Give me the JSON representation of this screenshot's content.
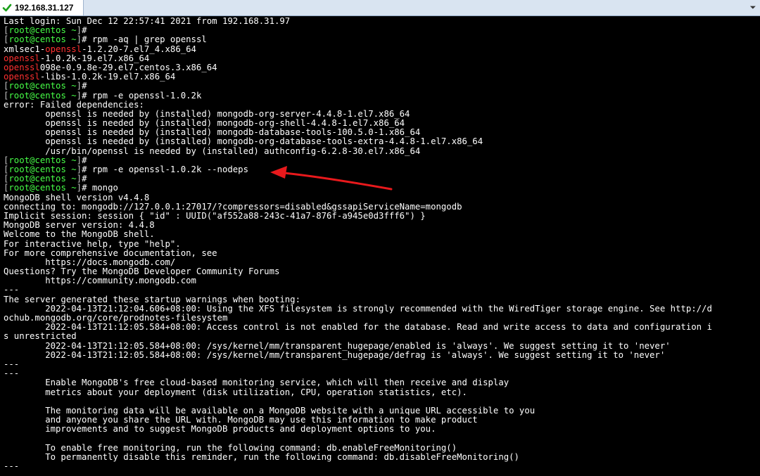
{
  "tab": {
    "title": "192.168.31.127",
    "menu_icon": "chevron-down-icon",
    "status_icon": "check-icon"
  },
  "prompt": {
    "bracket_open": "[",
    "user_host": "root@centos",
    "path": "~",
    "bracket_close": "]",
    "symbol": "#"
  },
  "colors": {
    "prompt_user": "#47ff47",
    "highlight": "#ff3030",
    "arrow": "#e8191c"
  },
  "lines": {
    "l01": "Last login: Sun Dec 12 22:57:41 2021 from 192.168.31.97",
    "l02": "",
    "l03": " rpm -aq | grep openssl",
    "l04a": "xmlsec1-",
    "l04b": "openssl",
    "l04c": "-1.2.20-7.el7_4.x86_64",
    "l05a": "openssl",
    "l05b": "-1.0.2k-19.el7.x86_64",
    "l06a": "openssl",
    "l06b": "098e-0.9.8e-29.el7.centos.3.x86_64",
    "l07a": "openssl",
    "l07b": "-libs-1.0.2k-19.el7.x86_64",
    "l08": "",
    "l09": " rpm -e openssl-1.0.2k",
    "l10": "error: Failed dependencies:",
    "l11": "        openssl is needed by (installed) mongodb-org-server-4.4.8-1.el7.x86_64",
    "l12": "        openssl is needed by (installed) mongodb-org-shell-4.4.8-1.el7.x86_64",
    "l13": "        openssl is needed by (installed) mongodb-database-tools-100.5.0-1.x86_64",
    "l14": "        openssl is needed by (installed) mongodb-org-database-tools-extra-4.4.8-1.el7.x86_64",
    "l15": "        /usr/bin/openssl is needed by (installed) authconfig-6.2.8-30.el7.x86_64",
    "l16": "",
    "l17": " rpm -e openssl-1.0.2k --nodeps",
    "l18": "",
    "l19": " mongo",
    "l20": "MongoDB shell version v4.4.8",
    "l21": "connecting to: mongodb://127.0.0.1:27017/?compressors=disabled&gssapiServiceName=mongodb",
    "l22": "Implicit session: session { \"id\" : UUID(\"af552a88-243c-41a7-876f-a945e0d3fff6\") }",
    "l23": "MongoDB server version: 4.4.8",
    "l24": "Welcome to the MongoDB shell.",
    "l25": "For interactive help, type \"help\".",
    "l26": "For more comprehensive documentation, see",
    "l27": "        https://docs.mongodb.com/",
    "l28": "Questions? Try the MongoDB Developer Community Forums",
    "l29": "        https://community.mongodb.com",
    "l30": "---",
    "l31": "The server generated these startup warnings when booting:",
    "l32": "        2022-04-13T21:12:04.606+08:00: Using the XFS filesystem is strongly recommended with the WiredTiger storage engine. See http://d",
    "l33": "ochub.mongodb.org/core/prodnotes-filesystem",
    "l34": "        2022-04-13T21:12:05.584+08:00: Access control is not enabled for the database. Read and write access to data and configuration i",
    "l35": "s unrestricted",
    "l36": "        2022-04-13T21:12:05.584+08:00: /sys/kernel/mm/transparent_hugepage/enabled is 'always'. We suggest setting it to 'never'",
    "l37": "        2022-04-13T21:12:05.584+08:00: /sys/kernel/mm/transparent_hugepage/defrag is 'always'. We suggest setting it to 'never'",
    "l38": "---",
    "l39": "---",
    "l40": "        Enable MongoDB's free cloud-based monitoring service, which will then receive and display",
    "l41": "        metrics about your deployment (disk utilization, CPU, operation statistics, etc).",
    "l42": "",
    "l43": "        The monitoring data will be available on a MongoDB website with a unique URL accessible to you",
    "l44": "        and anyone you share the URL with. MongoDB may use this information to make product",
    "l45": "        improvements and to suggest MongoDB products and deployment options to you.",
    "l46": "",
    "l47": "        To enable free monitoring, run the following command: db.enableFreeMonitoring()",
    "l48": "        To permanently disable this reminder, run the following command: db.disableFreeMonitoring()",
    "l49": "---"
  }
}
